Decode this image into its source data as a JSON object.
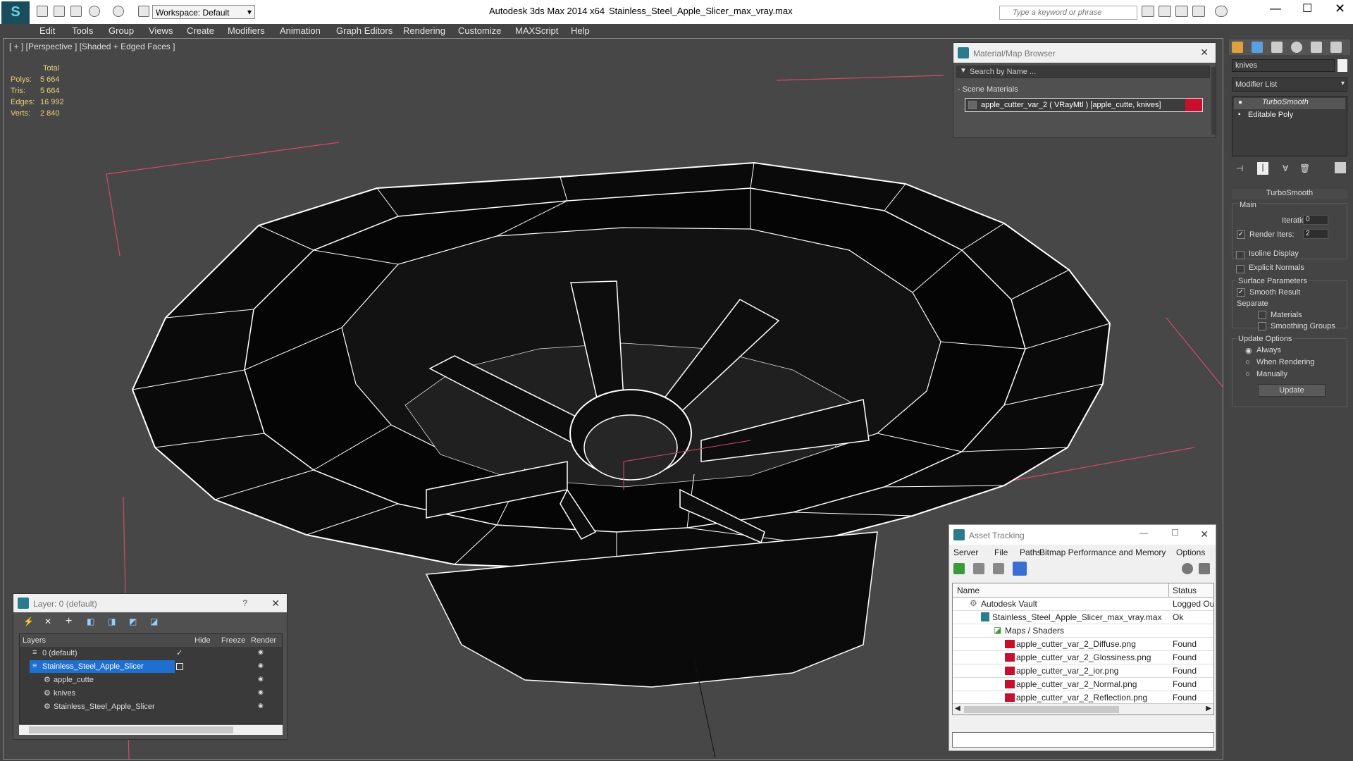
{
  "title": {
    "workspace": "Workspace: Default",
    "app": "Autodesk 3ds Max  2014 x64",
    "file": "Stainless_Steel_Apple_Slicer_max_vray.max",
    "search_placeholder": "Type a keyword or phrase"
  },
  "menu": [
    "Edit",
    "Tools",
    "Group",
    "Views",
    "Create",
    "Modifiers",
    "Animation",
    "Graph Editors",
    "Rendering",
    "Customize",
    "MAXScript",
    "Help"
  ],
  "viewport": {
    "label": "[ + ] [Perspective ] [Shaded + Edged Faces ]",
    "stats": {
      "header": "Total",
      "rows": [
        {
          "k": "Polys:",
          "v": "5 664"
        },
        {
          "k": "Tris:",
          "v": "5 664"
        },
        {
          "k": "Edges:",
          "v": "16 992"
        },
        {
          "k": "Verts:",
          "v": "2 840"
        }
      ]
    }
  },
  "material_browser": {
    "title": "Material/Map Browser",
    "search_placeholder": "Search by Name ...",
    "group": "- Scene Materials",
    "item": "apple_cutter_var_2  ( VRayMtl )  [apple_cutte, knives]"
  },
  "command_panel": {
    "name_field": "knives",
    "modifier_list": "Modifier List",
    "stack": [
      "TurboSmooth",
      "Editable Poly"
    ],
    "rollout_title": "TurboSmooth",
    "main": "Main",
    "iterations_label": "Iterations:",
    "iterations_val": "0",
    "render_iters_label": "Render Iters:",
    "render_iters_val": "2",
    "isoline": "Isoline Display",
    "explicit": "Explicit Normals",
    "surface": "Surface Parameters",
    "smooth_result": "Smooth Result",
    "separate": "Separate",
    "materials": "Materials",
    "smoothing_groups": "Smoothing Groups",
    "update_options": "Update Options",
    "always": "Always",
    "when_rendering": "When Rendering",
    "manually": "Manually",
    "update_button": "Update"
  },
  "layers": {
    "title": "Layer: 0 (default)",
    "help": "?",
    "columns": [
      "Layers",
      "Hide",
      "Freeze",
      "Render"
    ],
    "rows": [
      "0 (default)",
      "Stainless_Steel_Apple_Slicer",
      "apple_cutte",
      "knives",
      "Stainless_Steel_Apple_Slicer"
    ]
  },
  "asset_tracking": {
    "title": "Asset Tracking",
    "menu": [
      "Server",
      "File",
      "Paths",
      "Bitmap Performance and Memory",
      "Options"
    ],
    "columns": [
      "Name",
      "Status"
    ],
    "rows": [
      {
        "name": "Autodesk Vault",
        "status": "Logged Ou"
      },
      {
        "name": "Stainless_Steel_Apple_Slicer_max_vray.max",
        "status": "Ok"
      },
      {
        "name": "Maps / Shaders",
        "status": ""
      },
      {
        "name": "apple_cutter_var_2_Diffuse.png",
        "status": "Found"
      },
      {
        "name": "apple_cutter_var_2_Glossiness.png",
        "status": "Found"
      },
      {
        "name": "apple_cutter_var_2_ior.png",
        "status": "Found"
      },
      {
        "name": "apple_cutter_var_2_Normal.png",
        "status": "Found"
      },
      {
        "name": "apple_cutter_var_2_Reflection.png",
        "status": "Found"
      }
    ]
  }
}
